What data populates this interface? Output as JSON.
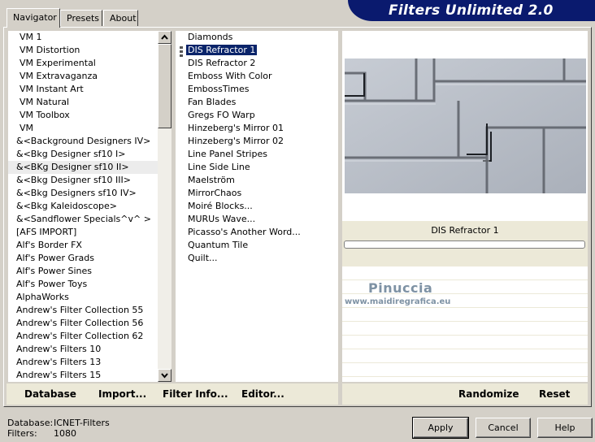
{
  "tabs": [
    {
      "label": "Navigator",
      "active": true
    },
    {
      "label": "Presets",
      "active": false
    },
    {
      "label": "About",
      "active": false
    }
  ],
  "title": "Filters Unlimited 2.0",
  "categories": [
    "VM 1",
    "VM Distortion",
    "VM Experimental",
    "VM Extravaganza",
    "VM Instant Art",
    "VM Natural",
    "VM Toolbox",
    "VM",
    "&<Background Designers IV>",
    "&<Bkg Designer sf10 I>",
    "&<BKg Designer sf10 II>",
    "&<Bkg Designer sf10 III>",
    "&<Bkg Designers sf10 IV>",
    "&<Bkg Kaleidoscope>",
    "&<Sandflower Specials^v^ >",
    "[AFS IMPORT]",
    "Alf's Border FX",
    "Alf's Power Grads",
    "Alf's Power Sines",
    "Alf's Power Toys",
    "AlphaWorks",
    "Andrew's Filter Collection 55",
    "Andrew's Filter Collection 56",
    "Andrew's Filter Collection 62",
    "Andrew's Filters 10",
    "Andrew's Filters 13",
    "Andrew's Filters 15"
  ],
  "selected_category": "&<BKg Designer sf10 II>",
  "filters": [
    "Diamonds",
    "DIS Refractor 1",
    "DIS Refractor 2",
    "Emboss With Color",
    "EmbossTimes",
    "Fan Blades",
    "Gregs FO Warp",
    "Hinzeberg's Mirror 01",
    "Hinzeberg's Mirror 02",
    "Line Panel Stripes",
    "Line Side Line",
    "Maelström",
    "MirrorChaos",
    "Moiré Blocks...",
    "MURUs Wave...",
    "Picasso's Another Word...",
    "Quantum Tile",
    "Quilt..."
  ],
  "selected_filter": "DIS Refractor 1",
  "preview": {
    "filter_name": "DIS Refractor 1",
    "progress": 0
  },
  "watermark": {
    "name": "Pinuccia",
    "site": "www.maidiregrafica.eu"
  },
  "toolbar": {
    "database": "Database",
    "import": "Import...",
    "filter_info": "Filter Info...",
    "editor": "Editor...",
    "randomize": "Randomize",
    "reset": "Reset"
  },
  "status": {
    "database_label": "Database:",
    "database_value": "ICNET-Filters",
    "filters_label": "Filters:",
    "filters_value": "1080"
  },
  "buttons": {
    "apply": "Apply",
    "cancel": "Cancel",
    "help": "Help"
  },
  "colors": {
    "banner": "#0a1a6e",
    "selection": "#0a246a",
    "face": "#d4d0c8"
  }
}
